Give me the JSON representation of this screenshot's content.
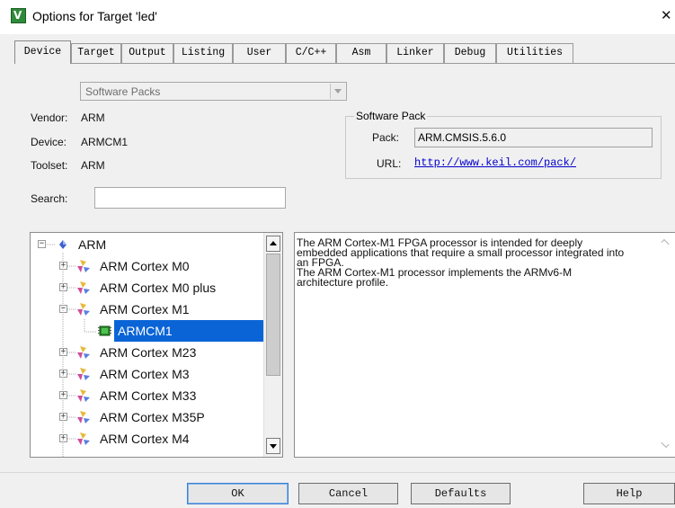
{
  "window": {
    "title": "Options for Target 'led'",
    "app_icon_letter": "V",
    "close_glyph": "✕"
  },
  "tabs": [
    {
      "label": "Device",
      "active": true
    },
    {
      "label": "Target"
    },
    {
      "label": "Output"
    },
    {
      "label": "Listing"
    },
    {
      "label": "User"
    },
    {
      "label": "C/C++"
    },
    {
      "label": "Asm"
    },
    {
      "label": "Linker"
    },
    {
      "label": "Debug"
    },
    {
      "label": "Utilities"
    }
  ],
  "packs_combo": {
    "value": "Software Packs"
  },
  "device_info": {
    "vendor_label": "Vendor:",
    "vendor": "ARM",
    "device_label": "Device:",
    "device": "ARMCM1",
    "toolset_label": "Toolset:",
    "toolset": "ARM"
  },
  "software_pack": {
    "title": "Software Pack",
    "pack_label": "Pack:",
    "pack": "ARM.CMSIS.5.6.0",
    "url_label": "URL:",
    "url": "http://www.keil.com/pack/"
  },
  "search": {
    "label": "Search:",
    "value": ""
  },
  "tree": {
    "root": "ARM",
    "items": [
      {
        "label": "ARM Cortex M0",
        "expanded": false
      },
      {
        "label": "ARM Cortex M0 plus",
        "expanded": false
      },
      {
        "label": "ARM Cortex M1",
        "expanded": true
      },
      {
        "label": "ARMCM1",
        "selected": true
      },
      {
        "label": "ARM Cortex M23",
        "expanded": false
      },
      {
        "label": "ARM Cortex M3",
        "expanded": false
      },
      {
        "label": "ARM Cortex M33",
        "expanded": false
      },
      {
        "label": "ARM Cortex M35P",
        "expanded": false
      },
      {
        "label": "ARM Cortex M4",
        "expanded": false
      }
    ]
  },
  "description": {
    "lines": [
      "The ARM Cortex-M1 FPGA processor is intended for deeply",
      "embedded applications that require a small processor integrated into",
      "an FPGA.",
      "The ARM Cortex-M1 processor implements the ARMv6-M",
      "architecture profile."
    ]
  },
  "buttons": {
    "ok": "OK",
    "cancel": "Cancel",
    "defaults": "Defaults",
    "help": "Help"
  },
  "colors": {
    "selection": "#0a64d6",
    "link": "#0000cc",
    "app_icon": "#2f8a3a"
  }
}
